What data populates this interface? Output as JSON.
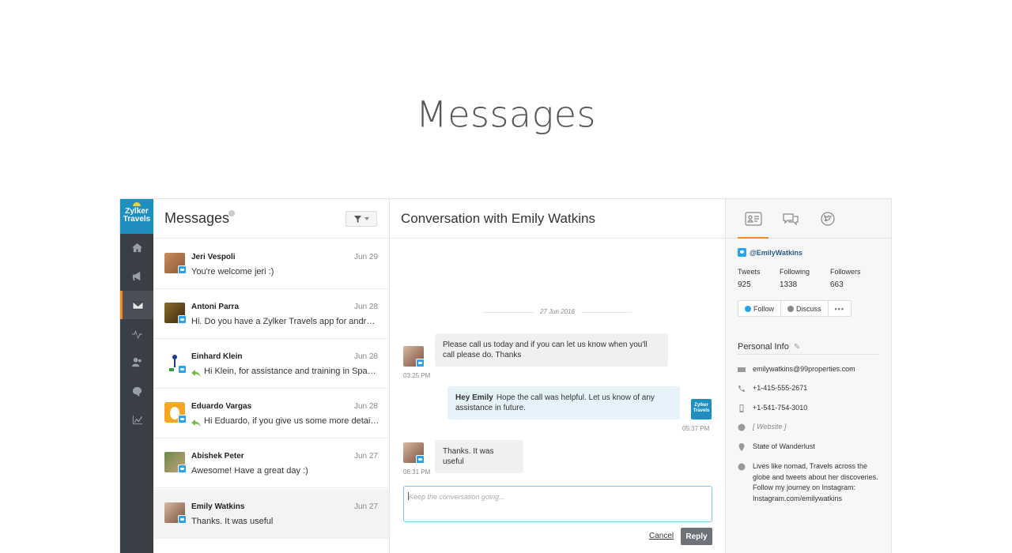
{
  "page_title": "Messages",
  "brand": {
    "line1": "Zylker",
    "line2": "Travels"
  },
  "list": {
    "title": "Messages",
    "items": [
      {
        "name": "Jeri Vespoli",
        "date": "Jun 29",
        "text": "You're welcome jeri :)",
        "reply": false
      },
      {
        "name": "Antoni Parra",
        "date": "Jun 28",
        "text": "Hi. Do you have a Zylker Travels app for android? I couldn't find it",
        "reply": false
      },
      {
        "name": "Einhard Klein",
        "date": "Jun 28",
        "text": "Hi Klein, for assistance and training in Spanish, please contact us",
        "reply": true
      },
      {
        "name": "Eduardo Vargas",
        "date": "Jun 28",
        "text": "Hi Eduardo, if you give us some more details, we can help",
        "reply": true
      },
      {
        "name": "Abishek Peter",
        "date": "Jun 27",
        "text": "Awesome! Have a great day :)",
        "reply": false
      },
      {
        "name": "Emily Watkins",
        "date": "Jun 27",
        "text": "Thanks. It was useful",
        "reply": false
      }
    ]
  },
  "conversation": {
    "title": "Conversation with Emily Watkins",
    "date_separator": "27 Jun 2016",
    "messages": [
      {
        "text": "Please call us today and if you can let us know when you'll call please do. Thanks",
        "time": "03:25 PM"
      },
      {
        "greeting": "Hey Emily",
        "text": "Hope the call was helpful. Let us know of any assistance in future.",
        "time": "05:37 PM"
      },
      {
        "text": "Thanks. It was useful",
        "time": "06:31 PM"
      }
    ],
    "composer_placeholder": "Keep the conversation going...",
    "cancel_label": "Cancel",
    "reply_label": "Reply"
  },
  "profile": {
    "handle": "@EmilyWatkins",
    "stats": [
      {
        "label": "Tweets",
        "value": "925"
      },
      {
        "label": "Following",
        "value": "1338"
      },
      {
        "label": "Followers",
        "value": "663"
      }
    ],
    "follow_label": "Follow",
    "discuss_label": "Discuss",
    "more_label": "•••",
    "personal_info_title": "Personal Info",
    "email": "emilywatkins@99properties.com",
    "phone": "+1-415-555-2671",
    "mobile": "+1-541-754-3010",
    "website": "[ Website ]",
    "location": "State of Wanderlust",
    "bio": "Lives like nomad, Travels across the globe and tweets about her discoveries. Follow my journey on Instagram: Instagram.com/emilywatkins"
  },
  "colors": {
    "accent": "#f08a24",
    "twitter": "#2aa3ef",
    "rail": "#3a3e45",
    "brand": "#1e8fbf"
  }
}
